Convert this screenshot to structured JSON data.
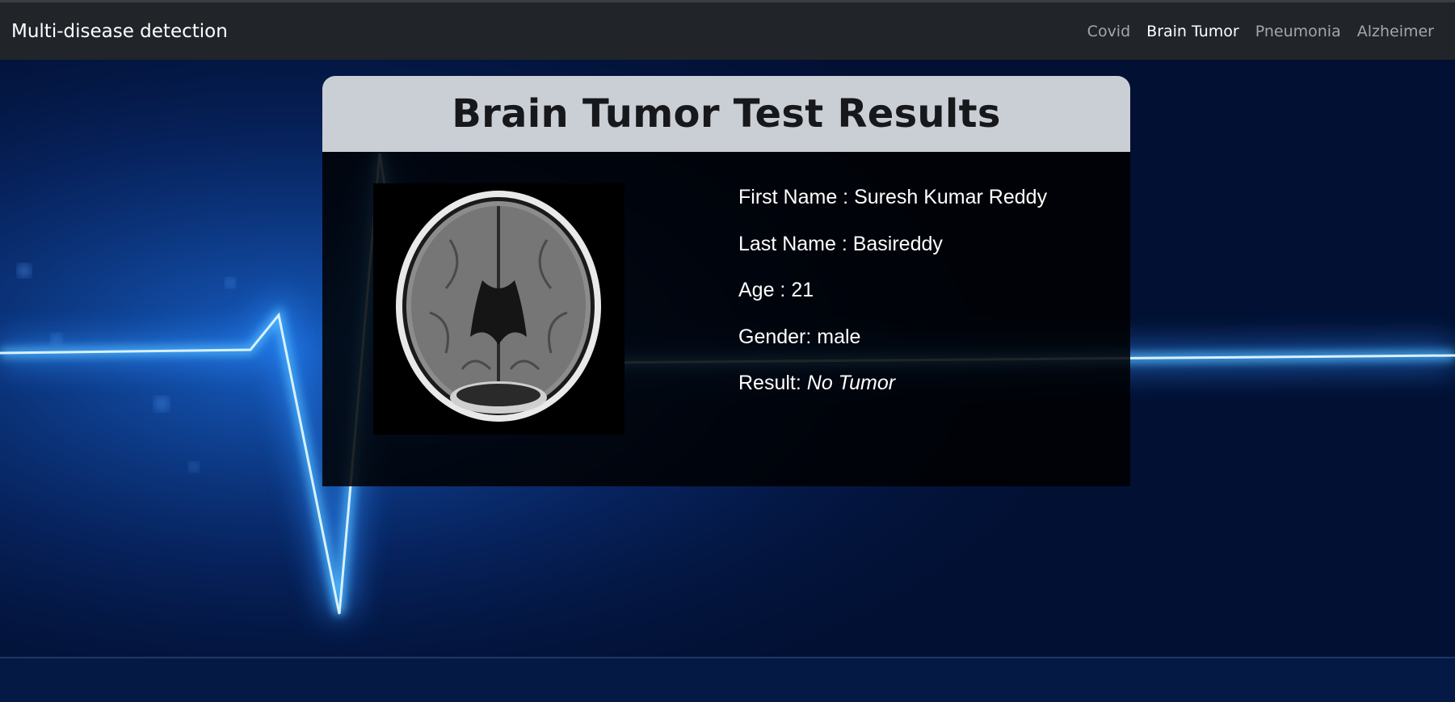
{
  "navbar": {
    "brand": "Multi-disease detection",
    "links": [
      {
        "label": "Covid",
        "active": false
      },
      {
        "label": "Brain Tumor",
        "active": true
      },
      {
        "label": "Pneumonia",
        "active": false
      },
      {
        "label": "Alzheimer",
        "active": false
      }
    ]
  },
  "card": {
    "title": "Brain Tumor Test Results",
    "patient": {
      "first_name": "First Name : Suresh Kumar Reddy",
      "last_name": "Last Name : Basireddy",
      "age": "Age : 21",
      "gender": "Gender: male",
      "result_label": "Result: ",
      "result_value": "No Tumor"
    }
  },
  "colors": {
    "navbar_bg": "#212529",
    "header_bg": "#cacfd6",
    "background": "#021033",
    "pulse": "#35aaff"
  }
}
